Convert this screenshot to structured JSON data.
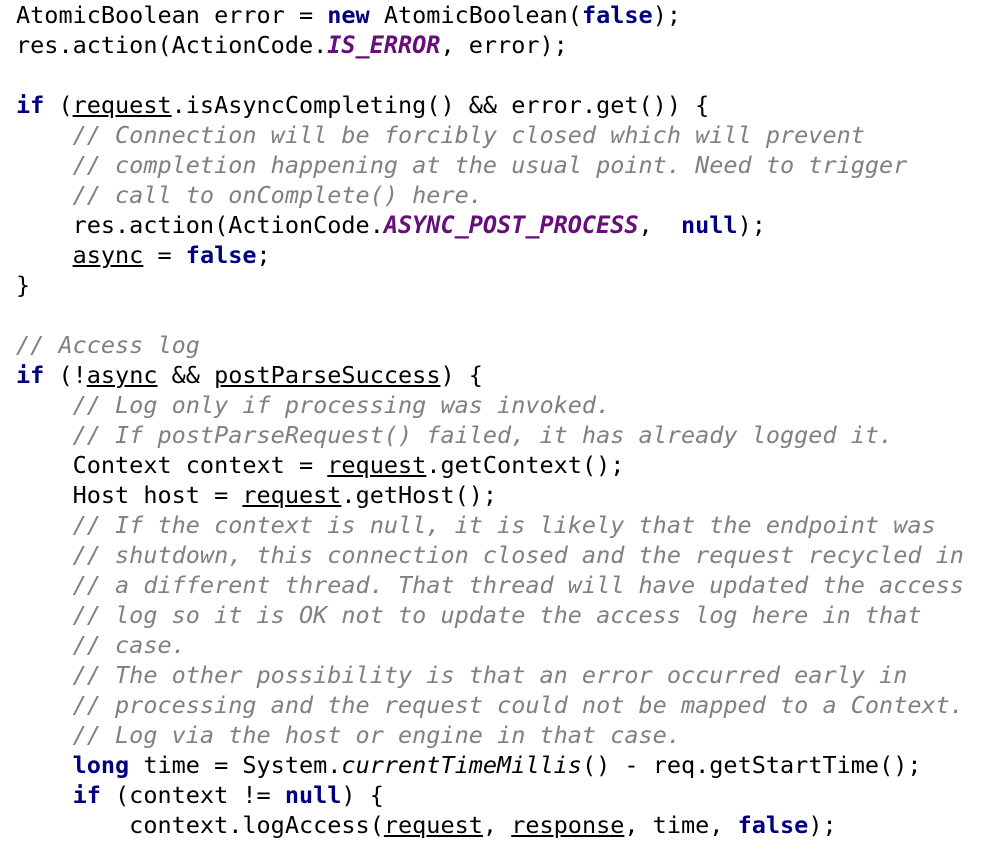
{
  "code": {
    "lines": [
      [
        {
          "t": "AtomicBoolean error = ",
          "c": ""
        },
        {
          "t": "new",
          "c": "kw"
        },
        {
          "t": " AtomicBoolean(",
          "c": ""
        },
        {
          "t": "false",
          "c": "kw"
        },
        {
          "t": ");",
          "c": ""
        }
      ],
      [
        {
          "t": "res.action(ActionCode.",
          "c": ""
        },
        {
          "t": "IS_ERROR",
          "c": "cons"
        },
        {
          "t": ", error);",
          "c": ""
        }
      ],
      [],
      [
        {
          "t": "if",
          "c": "kw"
        },
        {
          "t": " (",
          "c": ""
        },
        {
          "t": "request",
          "c": "ul"
        },
        {
          "t": ".isAsyncCompleting() && error.get()) {",
          "c": ""
        }
      ],
      [
        {
          "t": "    ",
          "c": ""
        },
        {
          "t": "// Connection will be forcibly closed which will prevent",
          "c": "cm"
        }
      ],
      [
        {
          "t": "    ",
          "c": ""
        },
        {
          "t": "// completion happening at the usual point. Need to trigger",
          "c": "cm"
        }
      ],
      [
        {
          "t": "    ",
          "c": ""
        },
        {
          "t": "// call to onComplete() here.",
          "c": "cm"
        }
      ],
      [
        {
          "t": "    res.action(ActionCode.",
          "c": ""
        },
        {
          "t": "ASYNC_POST_PROCESS",
          "c": "cons"
        },
        {
          "t": ",  ",
          "c": ""
        },
        {
          "t": "null",
          "c": "kw"
        },
        {
          "t": ");",
          "c": ""
        }
      ],
      [
        {
          "t": "    ",
          "c": ""
        },
        {
          "t": "async",
          "c": "ul"
        },
        {
          "t": " = ",
          "c": ""
        },
        {
          "t": "false",
          "c": "kw"
        },
        {
          "t": ";",
          "c": ""
        }
      ],
      [
        {
          "t": "}",
          "c": ""
        }
      ],
      [],
      [
        {
          "t": "// Access log",
          "c": "cm"
        }
      ],
      [
        {
          "t": "if",
          "c": "kw"
        },
        {
          "t": " (!",
          "c": ""
        },
        {
          "t": "async",
          "c": "ul"
        },
        {
          "t": " && ",
          "c": ""
        },
        {
          "t": "postParseSuccess",
          "c": "ul"
        },
        {
          "t": ") {",
          "c": ""
        }
      ],
      [
        {
          "t": "    ",
          "c": ""
        },
        {
          "t": "// Log only if processing was invoked.",
          "c": "cm"
        }
      ],
      [
        {
          "t": "    ",
          "c": ""
        },
        {
          "t": "// If postParseRequest() failed, it has already logged it.",
          "c": "cm"
        }
      ],
      [
        {
          "t": "    Context context = ",
          "c": ""
        },
        {
          "t": "request",
          "c": "ul"
        },
        {
          "t": ".getContext();",
          "c": ""
        }
      ],
      [
        {
          "t": "    Host host = ",
          "c": ""
        },
        {
          "t": "request",
          "c": "ul"
        },
        {
          "t": ".getHost();",
          "c": ""
        }
      ],
      [
        {
          "t": "    ",
          "c": ""
        },
        {
          "t": "// If the context is null, it is likely that the endpoint was",
          "c": "cm"
        }
      ],
      [
        {
          "t": "    ",
          "c": ""
        },
        {
          "t": "// shutdown, this connection closed and the request recycled in",
          "c": "cm"
        }
      ],
      [
        {
          "t": "    ",
          "c": ""
        },
        {
          "t": "// a different thread. That thread will have updated the access",
          "c": "cm"
        }
      ],
      [
        {
          "t": "    ",
          "c": ""
        },
        {
          "t": "// log so it is OK not to update the access log here in that",
          "c": "cm"
        }
      ],
      [
        {
          "t": "    ",
          "c": ""
        },
        {
          "t": "// case.",
          "c": "cm"
        }
      ],
      [
        {
          "t": "    ",
          "c": ""
        },
        {
          "t": "// The other possibility is that an error occurred early in",
          "c": "cm"
        }
      ],
      [
        {
          "t": "    ",
          "c": ""
        },
        {
          "t": "// processing and the request could not be mapped to a Context.",
          "c": "cm"
        }
      ],
      [
        {
          "t": "    ",
          "c": ""
        },
        {
          "t": "// Log via the host or engine in that case.",
          "c": "cm"
        }
      ],
      [
        {
          "t": "    ",
          "c": ""
        },
        {
          "t": "long",
          "c": "kw"
        },
        {
          "t": " time = System.",
          "c": ""
        },
        {
          "t": "currentTimeMillis",
          "c": "stm"
        },
        {
          "t": "() - req.getStartTime();",
          "c": ""
        }
      ],
      [
        {
          "t": "    ",
          "c": ""
        },
        {
          "t": "if",
          "c": "kw"
        },
        {
          "t": " (context != ",
          "c": ""
        },
        {
          "t": "null",
          "c": "kw"
        },
        {
          "t": ") {",
          "c": ""
        }
      ],
      [
        {
          "t": "        context.logAccess(",
          "c": ""
        },
        {
          "t": "request",
          "c": "ul"
        },
        {
          "t": ", ",
          "c": ""
        },
        {
          "t": "response",
          "c": "ul"
        },
        {
          "t": ", time, ",
          "c": ""
        },
        {
          "t": "false",
          "c": "kw"
        },
        {
          "t": ");",
          "c": ""
        }
      ]
    ]
  }
}
